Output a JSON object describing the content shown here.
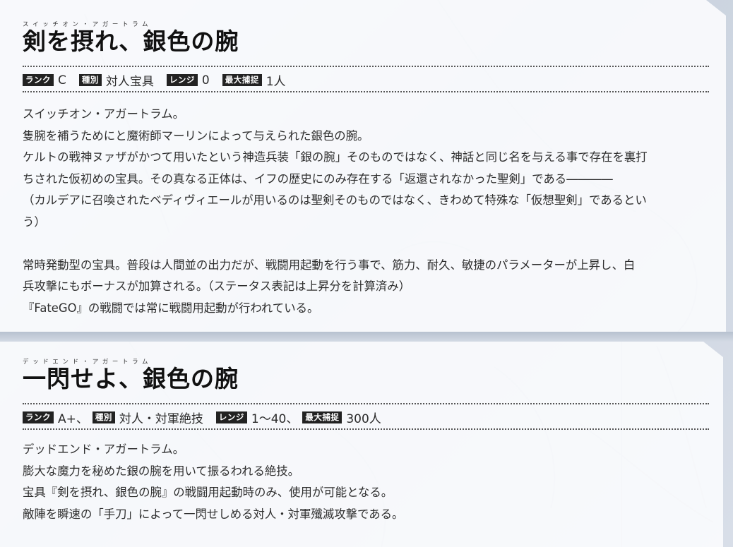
{
  "noble_phantasms": [
    {
      "ruby": "スイッチオン・アガートラム",
      "title": "剣を摂れ、銀色の腕",
      "stats": {
        "rank_label": "ランク",
        "rank_value": "C",
        "type_label": "種別",
        "type_value": "対人宝具",
        "range_label": "レンジ",
        "range_value": "0",
        "max_targets_label": "最大捕捉",
        "max_targets_value": "1人"
      },
      "description": [
        "スイッチオン・アガートラム。",
        "隻腕を補うためにと魔術師マーリンによって与えられた銀色の腕。",
        "ケルトの戦神ヌァザがかつて用いたという神造兵装「銀の腕」そのものではなく、神話と同じ名を与える事で存在を裏打",
        "ちされた仮初めの宝具。その真なる正体は、イフの歴史にのみ存在する「返還されなかった聖剣」である――――",
        "（カルデアに召喚されたベディヴィエールが用いるのは聖剣そのものではなく、きわめて特殊な「仮想聖剣」であるとい",
        "う）",
        "",
        "常時発動型の宝具。普段は人間並の出力だが、戦闘用起動を行う事で、筋力、耐久、敏捷のパラメーターが上昇し、白",
        "兵攻撃にもボーナスが加算される。（ステータス表記は上昇分を計算済み）",
        "『FateGO』の戦闘では常に戦闘用起動が行われている。"
      ]
    },
    {
      "ruby": "デッドエンド・アガートラム",
      "title": "一閃せよ、銀色の腕",
      "stats": {
        "rank_label": "ランク",
        "rank_value": "A+、",
        "type_label": "種別",
        "type_value": "対人・対軍絶技",
        "range_label": "レンジ",
        "range_value": "1～40、",
        "max_targets_label": "最大捕捉",
        "max_targets_value": "300人"
      },
      "description": [
        "デッドエンド・アガートラム。",
        "膨大な魔力を秘めた銀の腕を用いて振るわれる絶技。",
        "宝具『剣を摂れ、銀色の腕』の戦闘用起動時のみ、使用が可能となる。",
        "敵陣を瞬速の「手刀」によって一閃せしめる対人・対軍殲滅攻撃である。"
      ]
    }
  ]
}
